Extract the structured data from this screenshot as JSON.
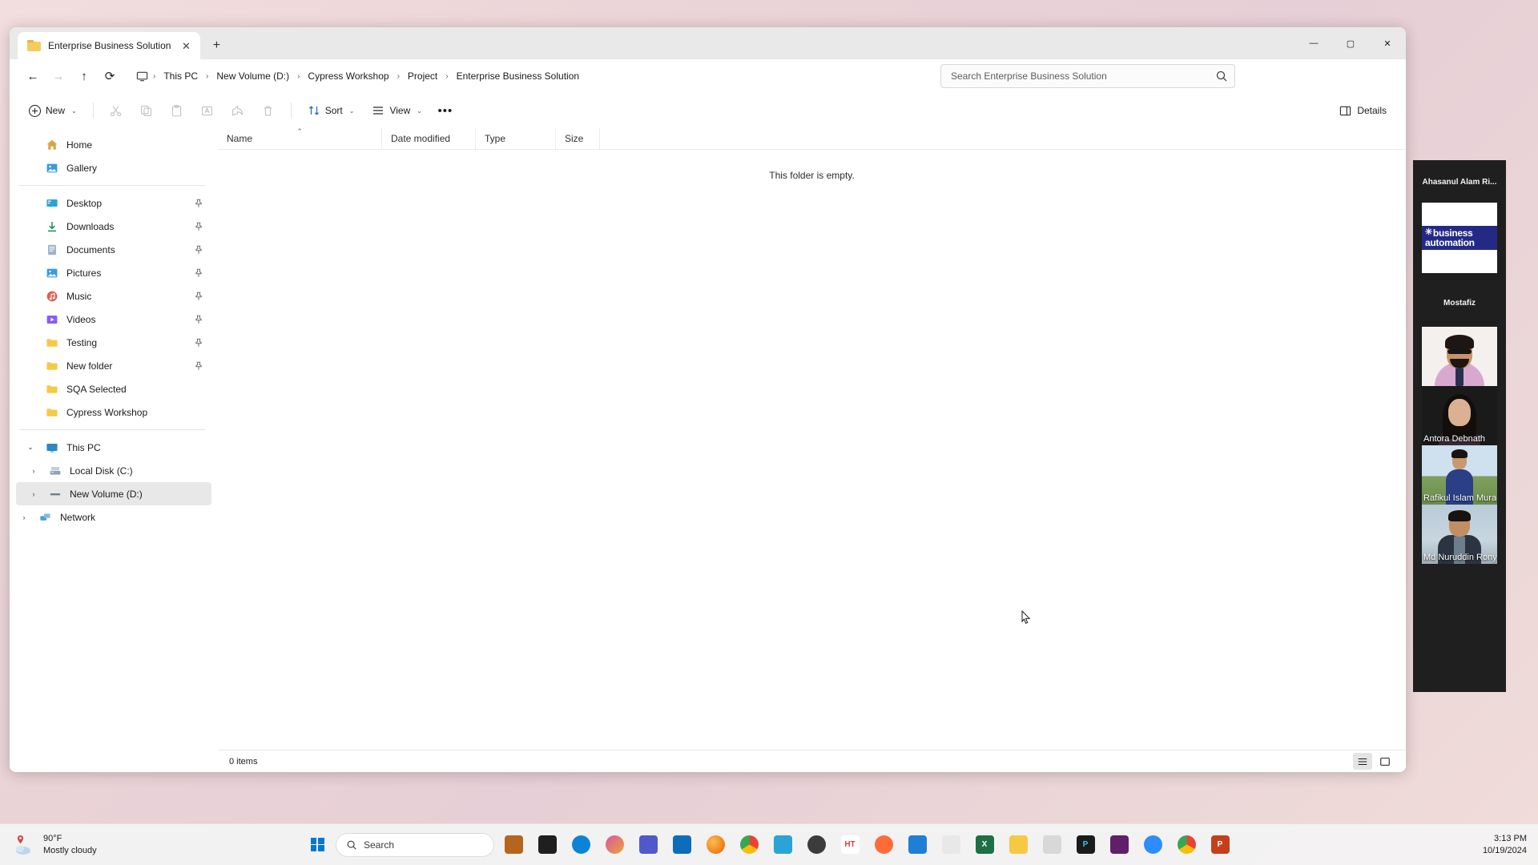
{
  "window": {
    "tab_title": "Enterprise Business Solution",
    "tab_close": "✕",
    "new_tab": "+",
    "minimize": "—",
    "maximize": "▢",
    "close": "✕"
  },
  "address": {
    "back": "←",
    "forward": "→",
    "up": "↑",
    "refresh": "⟳",
    "breadcrumbs": [
      {
        "label": "This PC"
      },
      {
        "label": "New Volume (D:)"
      },
      {
        "label": "Cypress Workshop"
      },
      {
        "label": "Project"
      },
      {
        "label": "Enterprise Business Solution"
      }
    ],
    "separator": "›"
  },
  "search": {
    "placeholder": "Search Enterprise Business Solution",
    "value": ""
  },
  "toolbar": {
    "new_label": "New",
    "caret": "⌄",
    "cut": "cut-icon",
    "copy": "copy-icon",
    "paste": "paste-icon",
    "rename": "rename-icon",
    "share": "share-icon",
    "delete": "delete-icon",
    "sort_label": "Sort",
    "view_label": "View",
    "more": "•••",
    "details_label": "Details"
  },
  "sidebar": {
    "quick": [
      {
        "label": "Home",
        "icon": "home-icon",
        "pinned": false
      },
      {
        "label": "Gallery",
        "icon": "gallery-icon",
        "pinned": false
      }
    ],
    "pinned": [
      {
        "label": "Desktop",
        "icon": "desktop-icon",
        "pinned": true
      },
      {
        "label": "Downloads",
        "icon": "downloads-icon",
        "pinned": true
      },
      {
        "label": "Documents",
        "icon": "documents-icon",
        "pinned": true
      },
      {
        "label": "Pictures",
        "icon": "pictures-icon",
        "pinned": true
      },
      {
        "label": "Music",
        "icon": "music-icon",
        "pinned": true
      },
      {
        "label": "Videos",
        "icon": "videos-icon",
        "pinned": true
      },
      {
        "label": "Testing",
        "icon": "folder-icon",
        "pinned": true
      },
      {
        "label": "New folder",
        "icon": "folder-icon",
        "pinned": true
      },
      {
        "label": "SQA Selected",
        "icon": "folder-icon",
        "pinned": false
      },
      {
        "label": "Cypress Workshop",
        "icon": "folder-icon",
        "pinned": false
      }
    ],
    "tree": [
      {
        "label": "This PC",
        "icon": "pc-icon",
        "expanded": true,
        "level": 0,
        "selected": false
      },
      {
        "label": "Local Disk (C:)",
        "icon": "disk-icon",
        "expanded": false,
        "level": 1,
        "selected": false
      },
      {
        "label": "New Volume (D:)",
        "icon": "volume-icon",
        "expanded": false,
        "level": 1,
        "selected": true
      },
      {
        "label": "Network",
        "icon": "network-icon",
        "expanded": false,
        "level": 0,
        "selected": false
      }
    ]
  },
  "filelist": {
    "columns": [
      {
        "label": "Name",
        "sorted": "asc"
      },
      {
        "label": "Date modified",
        "sorted": ""
      },
      {
        "label": "Type",
        "sorted": ""
      },
      {
        "label": "Size",
        "sorted": ""
      }
    ],
    "sort_caret": "⌃",
    "empty_message": "This folder is empty.",
    "rows": []
  },
  "statusbar": {
    "item_count": "0 items",
    "list_view": "list-view-icon",
    "details_view": "details-view-icon"
  },
  "videocall": {
    "speaker_name": "Ahasanul Alam Ri...",
    "logo_line1": "business",
    "logo_line2": "automation",
    "logo_star": "✳",
    "second_name": "Mostafiz",
    "participants": [
      {
        "name": "",
        "caption_visible": false
      },
      {
        "name": "Antora Debnath",
        "caption_visible": true
      },
      {
        "name": "Rafikul Islam Murad",
        "caption_visible": true
      },
      {
        "name": "Md Nuruddin Rony",
        "caption_visible": true
      }
    ]
  },
  "taskbar": {
    "weather_temp": "90°F",
    "weather_desc": "Mostly cloudy",
    "search_placeholder": "Search",
    "clock_time": "3:13 PM",
    "clock_date": "10/19/2024",
    "apps": [
      {
        "name": "file-explorer-pinned-icon",
        "color": "#b5651d",
        "glyph": ""
      },
      {
        "name": "terminal-icon",
        "color": "#1f1f1f",
        "glyph": ""
      },
      {
        "name": "edge-icon",
        "color": "#0b84d8",
        "glyph": ""
      },
      {
        "name": "copilot-icon",
        "color": "#d45aa0",
        "glyph": ""
      },
      {
        "name": "teams-icon",
        "color": "#5059c9",
        "glyph": ""
      },
      {
        "name": "outlook-icon",
        "color": "#0f6cbd",
        "glyph": ""
      },
      {
        "name": "firefox-icon",
        "color": "#e66000",
        "glyph": ""
      },
      {
        "name": "chrome-icon",
        "color": "#4285f4",
        "glyph": ""
      },
      {
        "name": "chart-app-icon",
        "color": "#2aa3d6",
        "glyph": ""
      },
      {
        "name": "disc-icon",
        "color": "#3c3c3c",
        "glyph": ""
      },
      {
        "name": "ht-app-icon",
        "color": "#e03a3a",
        "glyph": "HT"
      },
      {
        "name": "postman-icon",
        "color": "#ff6c37",
        "glyph": ""
      },
      {
        "name": "vscode-icon",
        "color": "#1f7fd4",
        "glyph": ""
      },
      {
        "name": "java-icon",
        "color": "#e8e8e8",
        "glyph": ""
      },
      {
        "name": "excel-icon",
        "color": "#1d7044",
        "glyph": "X"
      },
      {
        "name": "explorer-icon",
        "color": "#f6c945",
        "glyph": ""
      },
      {
        "name": "store-icon",
        "color": "#d8d8d8",
        "glyph": ""
      },
      {
        "name": "photoshop-icon",
        "color": "#1b1b1b",
        "glyph": "P"
      },
      {
        "name": "slack-icon",
        "color": "#611f69",
        "glyph": ""
      },
      {
        "name": "zoom-icon",
        "color": "#2d8cff",
        "glyph": ""
      },
      {
        "name": "chrome-beta-icon",
        "color": "#34a853",
        "glyph": ""
      },
      {
        "name": "powerpoint-icon",
        "color": "#c43e1c",
        "glyph": "P"
      }
    ]
  }
}
